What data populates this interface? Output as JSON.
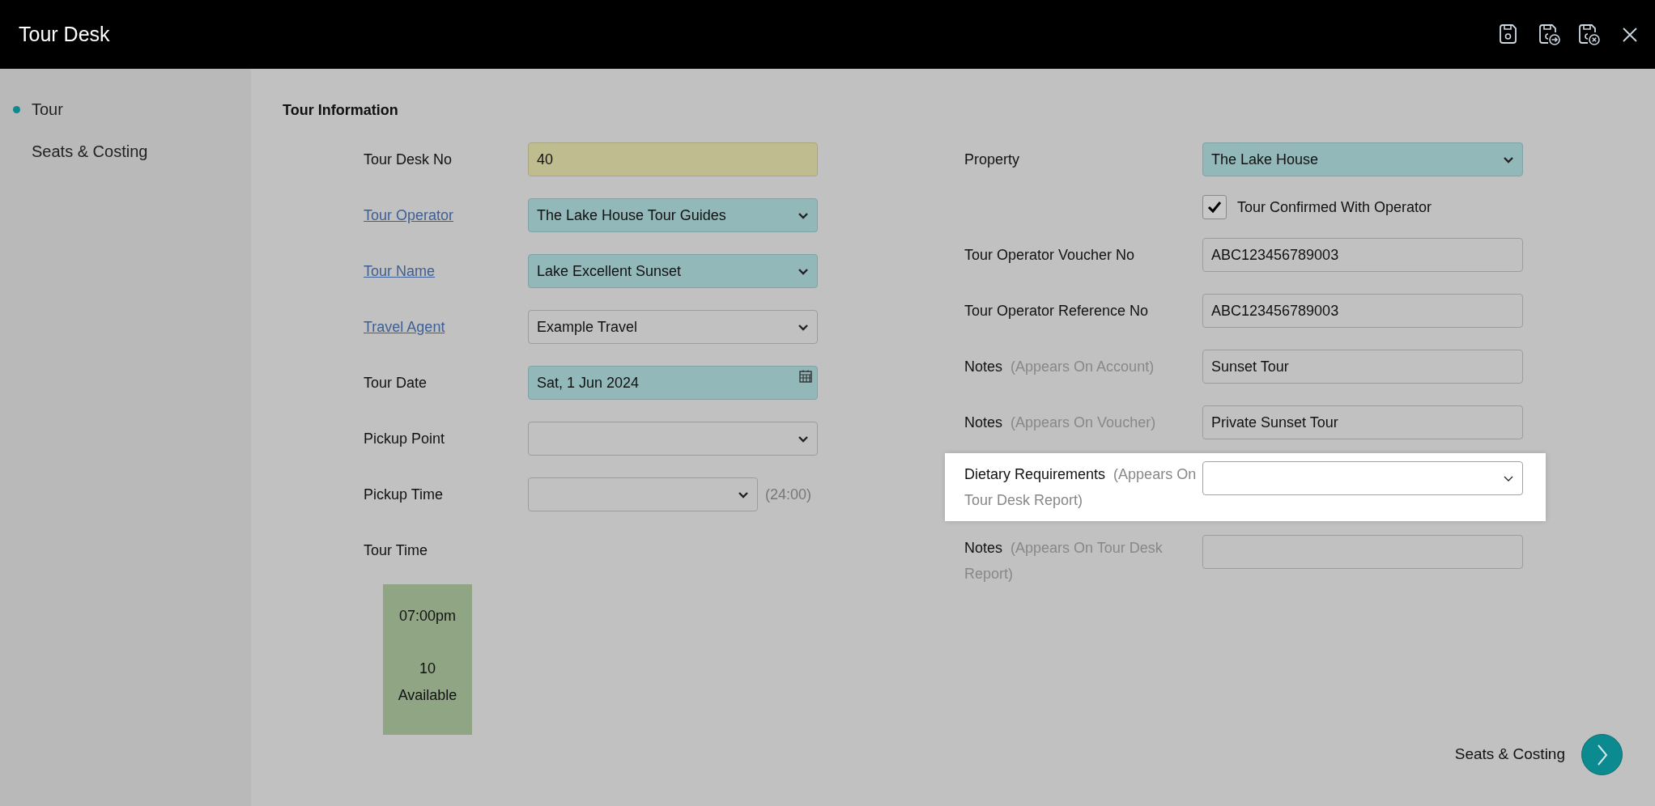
{
  "window": {
    "title": "Tour Desk"
  },
  "sidebar": {
    "items": [
      {
        "label": "Tour",
        "selected": true
      },
      {
        "label": "Seats & Costing",
        "selected": false
      }
    ]
  },
  "section_title": "Tour Information",
  "left_fields": [
    {
      "label": "Tour Desk No",
      "kind": "text",
      "link": false,
      "read_only": true,
      "value": "40"
    },
    {
      "label": "Tour Operator",
      "kind": "select",
      "link": true,
      "read_only": false,
      "required": true,
      "value": "The Lake House Tour Guides"
    },
    {
      "label": "Tour Name",
      "kind": "select",
      "link": true,
      "read_only": false,
      "required": true,
      "value": "Lake Excellent Sunset"
    },
    {
      "label": "Travel Agent",
      "kind": "select",
      "link": true,
      "read_only": false,
      "required": false,
      "value": "Example Travel"
    },
    {
      "label": "Tour Date",
      "kind": "date",
      "link": false,
      "read_only": false,
      "required": true,
      "value": "Sat, 1 Jun 2024"
    },
    {
      "label": "Pickup Point",
      "kind": "select",
      "link": false,
      "read_only": false,
      "required": false
    },
    {
      "label": "Pickup Time",
      "kind": "select",
      "link": false,
      "read_only": false,
      "required": false,
      "suffix": "(24:00)"
    },
    {
      "label": "Tour Time",
      "kind": "none",
      "link": false
    }
  ],
  "tour_times": [
    {
      "time": "07:00pm",
      "count": "10",
      "status": "Available"
    }
  ],
  "right_fields": [
    {
      "label": "Property",
      "kind": "select",
      "required": true,
      "value": "The Lake House",
      "highlighted": false
    },
    {
      "label": "Tour Confirmed With Operator",
      "kind": "checkbox",
      "checked": true,
      "highlighted": false
    },
    {
      "label": "Tour Operator Voucher No",
      "kind": "text",
      "required": false,
      "value": "ABC123456789003",
      "highlighted": false
    },
    {
      "label": "Tour Operator Reference No",
      "kind": "text",
      "required": false,
      "value": "ABC123456789003",
      "highlighted": false
    },
    {
      "label": "Notes",
      "hint": "(Appears On Account)",
      "kind": "text",
      "required": false,
      "value": "Sunset Tour",
      "highlighted": false
    },
    {
      "label": "Notes",
      "hint": "(Appears On Voucher)",
      "kind": "text",
      "required": false,
      "value": "Private Sunset Tour",
      "highlighted": false
    },
    {
      "label": "Dietary Requirements",
      "hint": "(Appears On Tour Desk Report)",
      "kind": "select",
      "highlighted": true
    },
    {
      "label": "Notes",
      "hint": "(Appears On Tour Desk Report)",
      "kind": "text",
      "required": false,
      "highlighted": false
    }
  ],
  "next_button": {
    "label": "Seats & Costing"
  }
}
